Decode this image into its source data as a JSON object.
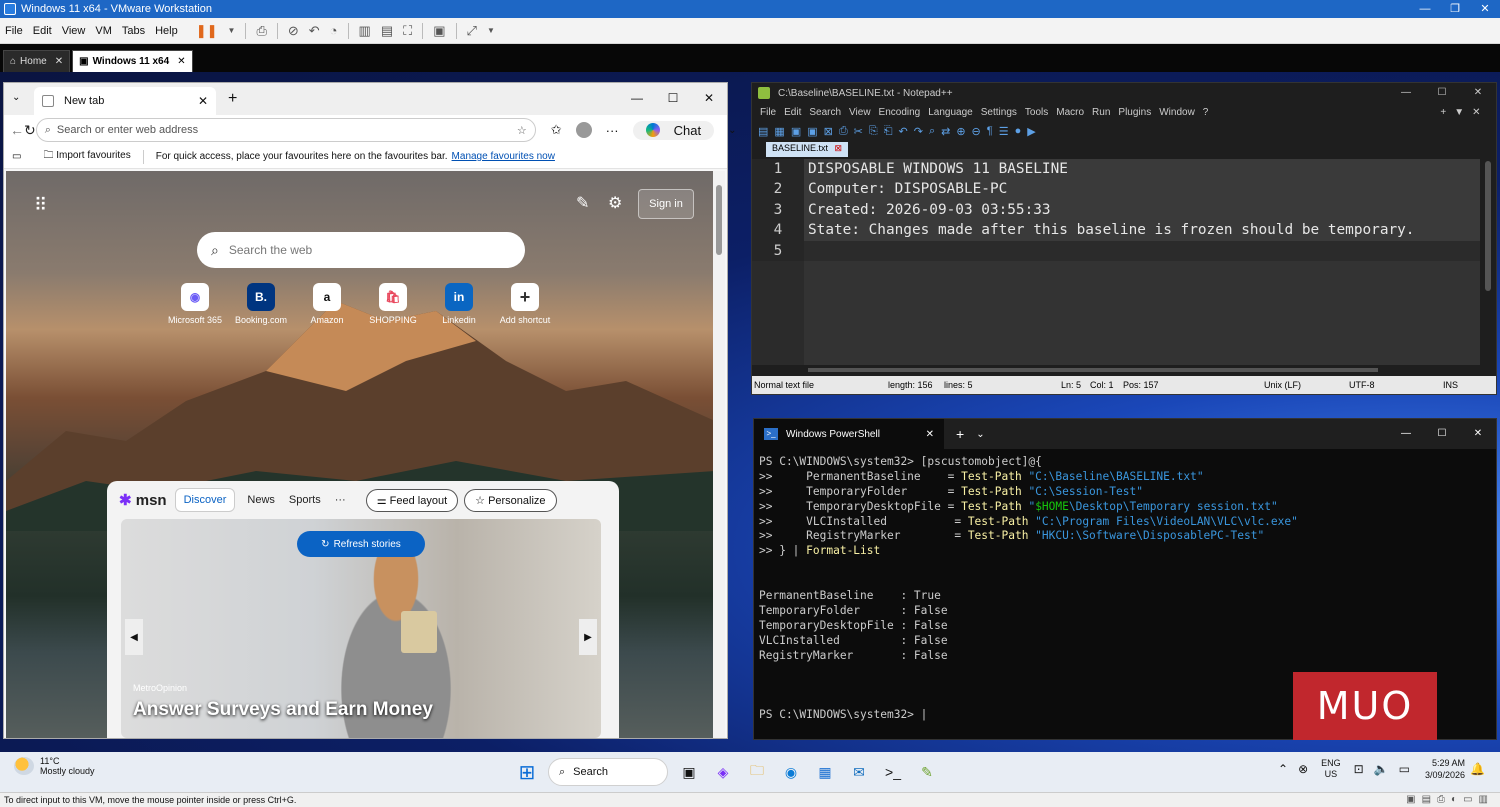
{
  "vm": {
    "title": "Windows 11 x64 - VMware Workstation",
    "menu": [
      "File",
      "Edit",
      "View",
      "VM",
      "Tabs",
      "Help"
    ],
    "tabs": [
      {
        "label": "Home"
      },
      {
        "label": "Windows 11 x64"
      }
    ],
    "status_text": "To direct input to this VM, move the mouse pointer inside or press Ctrl+G."
  },
  "edge": {
    "tab_title": "New tab",
    "address_placeholder": "Search or enter web address",
    "chat_label": "Chat",
    "favbar": {
      "import": "Import favourites",
      "hint": "For quick access, place your favourites here on the favourites bar.",
      "manage": "Manage favourites now"
    },
    "sign_in": "Sign in",
    "web_search_placeholder": "Search the web",
    "shortcuts": [
      {
        "label": "Microsoft 365",
        "icon": "microsoft-365-icon",
        "glyph": "◉",
        "color": "#6b5cf6"
      },
      {
        "label": "Booking.com",
        "icon": "booking-icon",
        "glyph": "B.",
        "color": "#003580"
      },
      {
        "label": "Amazon",
        "icon": "amazon-icon",
        "glyph": "a",
        "color": "#111111"
      },
      {
        "label": "SHOPPING",
        "icon": "shopping-icon",
        "glyph": "🛍",
        "color": "#e8445a"
      },
      {
        "label": "Linkedin",
        "icon": "linkedin-icon",
        "glyph": "in",
        "color": "#0a66c2"
      },
      {
        "label": "Add shortcut",
        "icon": "add-icon",
        "glyph": "+",
        "color": "#333333"
      }
    ],
    "msn": {
      "logo": "msn",
      "tabs": [
        "Discover",
        "News",
        "Sports",
        "···"
      ],
      "feed_layout": "Feed layout",
      "personalize": "Personalize",
      "refresh": "Refresh stories",
      "story_source": "MetroOpinion",
      "story_headline": "Answer Surveys and Earn Money"
    }
  },
  "notepad": {
    "title": "C:\\Baseline\\BASELINE.txt - Notepad++",
    "menu": [
      "File",
      "Edit",
      "Search",
      "View",
      "Encoding",
      "Language",
      "Settings",
      "Tools",
      "Macro",
      "Run",
      "Plugins",
      "Window",
      "?"
    ],
    "tab": "BASELINE.txt",
    "lines": [
      "DISPOSABLE WINDOWS 11 BASELINE",
      "Computer: DISPOSABLE-PC",
      "Created: 2026-09-03 03:55:33",
      "State: Changes made after this baseline is frozen should be temporary.",
      ""
    ],
    "line_numbers": [
      "1",
      "2",
      "3",
      "4",
      "5"
    ],
    "status": {
      "type": "Normal text file",
      "length": "length: 156",
      "lines": "lines: 5",
      "ln": "Ln: 5",
      "col": "Col: 1",
      "pos": "Pos: 157",
      "eol": "Unix (LF)",
      "encoding": "UTF-8",
      "mode": "INS"
    }
  },
  "powershell": {
    "tab_title": "Windows PowerShell",
    "lines": [
      [
        {
          "t": "PS C:\\WINDOWS\\system32> [pscustomobject]@{",
          "c": ""
        }
      ],
      [
        {
          "t": ">>     PermanentBaseline    = ",
          "c": ""
        },
        {
          "t": "Test-Path ",
          "c": "cmd"
        },
        {
          "t": "\"C:\\Baseline\\BASELINE.txt\"",
          "c": "str"
        }
      ],
      [
        {
          "t": ">>     TemporaryFolder      = ",
          "c": ""
        },
        {
          "t": "Test-Path ",
          "c": "cmd"
        },
        {
          "t": "\"C:\\Session-Test\"",
          "c": "str"
        }
      ],
      [
        {
          "t": ">>     TemporaryDesktopFile = ",
          "c": ""
        },
        {
          "t": "Test-Path ",
          "c": "cmd"
        },
        {
          "t": "\"",
          "c": "str"
        },
        {
          "t": "$HOME",
          "c": "var"
        },
        {
          "t": "\\Desktop\\Temporary session.txt\"",
          "c": "str"
        }
      ],
      [
        {
          "t": ">>     VLCInstalled          = ",
          "c": ""
        },
        {
          "t": "Test-Path ",
          "c": "cmd"
        },
        {
          "t": "\"C:\\Program Files\\VideoLAN\\VLC\\vlc.exe\"",
          "c": "str"
        }
      ],
      [
        {
          "t": ">>     RegistryMarker        = ",
          "c": ""
        },
        {
          "t": "Test-Path ",
          "c": "cmd"
        },
        {
          "t": "\"HKCU:\\Software\\DisposablePC-Test\"",
          "c": "str"
        }
      ],
      [
        {
          "t": ">> } | ",
          "c": ""
        },
        {
          "t": "Format-List",
          "c": "cmd"
        }
      ],
      [
        {
          "t": "",
          "c": ""
        }
      ],
      [
        {
          "t": "",
          "c": ""
        }
      ],
      [
        {
          "t": "PermanentBaseline    : True",
          "c": ""
        }
      ],
      [
        {
          "t": "TemporaryFolder      : False",
          "c": ""
        }
      ],
      [
        {
          "t": "TemporaryDesktopFile : False",
          "c": ""
        }
      ],
      [
        {
          "t": "VLCInstalled         : False",
          "c": ""
        }
      ],
      [
        {
          "t": "RegistryMarker       : False",
          "c": ""
        }
      ],
      [
        {
          "t": "",
          "c": ""
        }
      ],
      [
        {
          "t": "",
          "c": ""
        }
      ],
      [
        {
          "t": "",
          "c": ""
        }
      ],
      [
        {
          "t": "PS C:\\WINDOWS\\system32> ",
          "c": ""
        },
        {
          "t": "|",
          "c": "cursor"
        }
      ]
    ]
  },
  "watermark": "MUO",
  "taskbar": {
    "weather_temp": "11°C",
    "weather_desc": "Mostly cloudy",
    "search_label": "Search",
    "lang_top": "ENG",
    "lang_bottom": "US",
    "time": "5:29 AM",
    "date": "3/09/2026"
  },
  "colors": {
    "vmware_titlebar": "#1e67c5",
    "ps_string": "#3a96dd",
    "ps_command": "#f9f1a5",
    "ps_variable": "#16c60c",
    "muo_red": "#c1272d"
  }
}
